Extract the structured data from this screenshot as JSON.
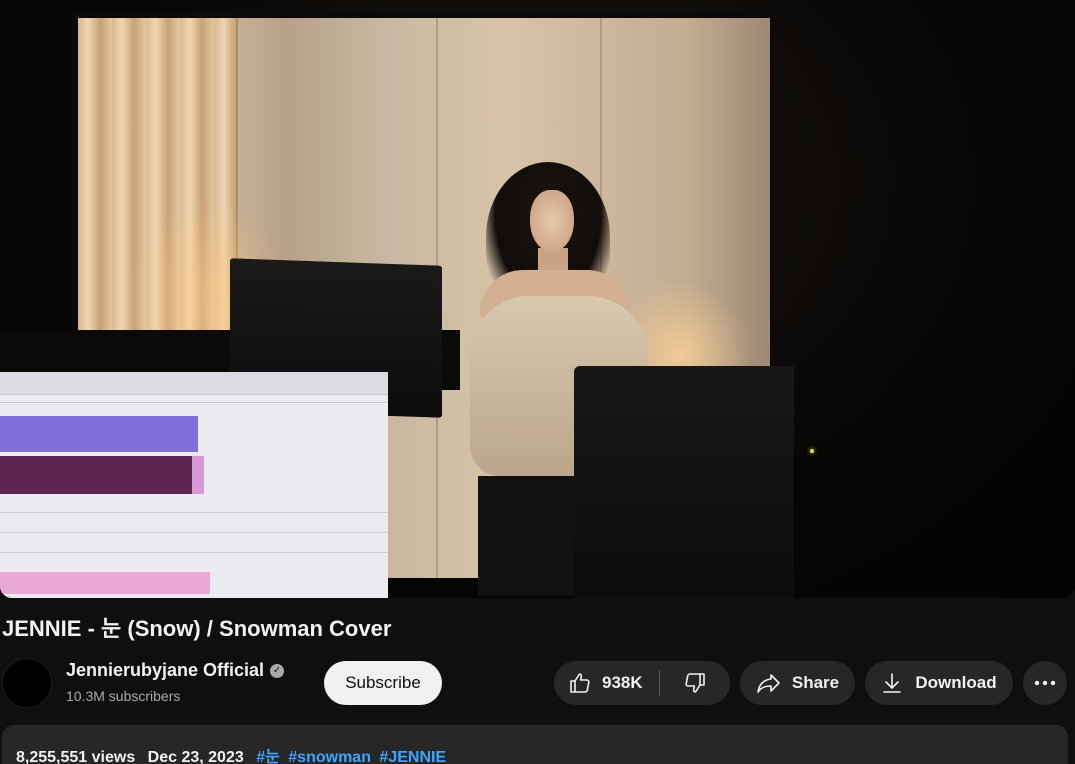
{
  "video": {
    "title": "JENNIE - 눈 (Snow) / Snowman Cover"
  },
  "channel": {
    "name": "Jennierubyjane Official",
    "subscribers": "10.3M subscribers",
    "verified": true
  },
  "actions": {
    "subscribe_label": "Subscribe",
    "like_count": "938K",
    "share_label": "Share",
    "download_label": "Download"
  },
  "description": {
    "views": "8,255,551 views",
    "date": "Dec 23, 2023",
    "hashtags": [
      "#눈",
      "#snowman",
      "#JENNIE"
    ]
  },
  "colors": {
    "background": "#0f0f0f",
    "pill": "#272727",
    "hashtag": "#3ea6ff",
    "subscribe_bg": "#f1f1f1"
  },
  "icons": {
    "like": "thumb-up-icon",
    "dislike": "thumb-down-icon",
    "share": "share-arrow-icon",
    "download": "download-icon",
    "more": "more-horizontal-icon",
    "verified": "verified-check-icon"
  }
}
